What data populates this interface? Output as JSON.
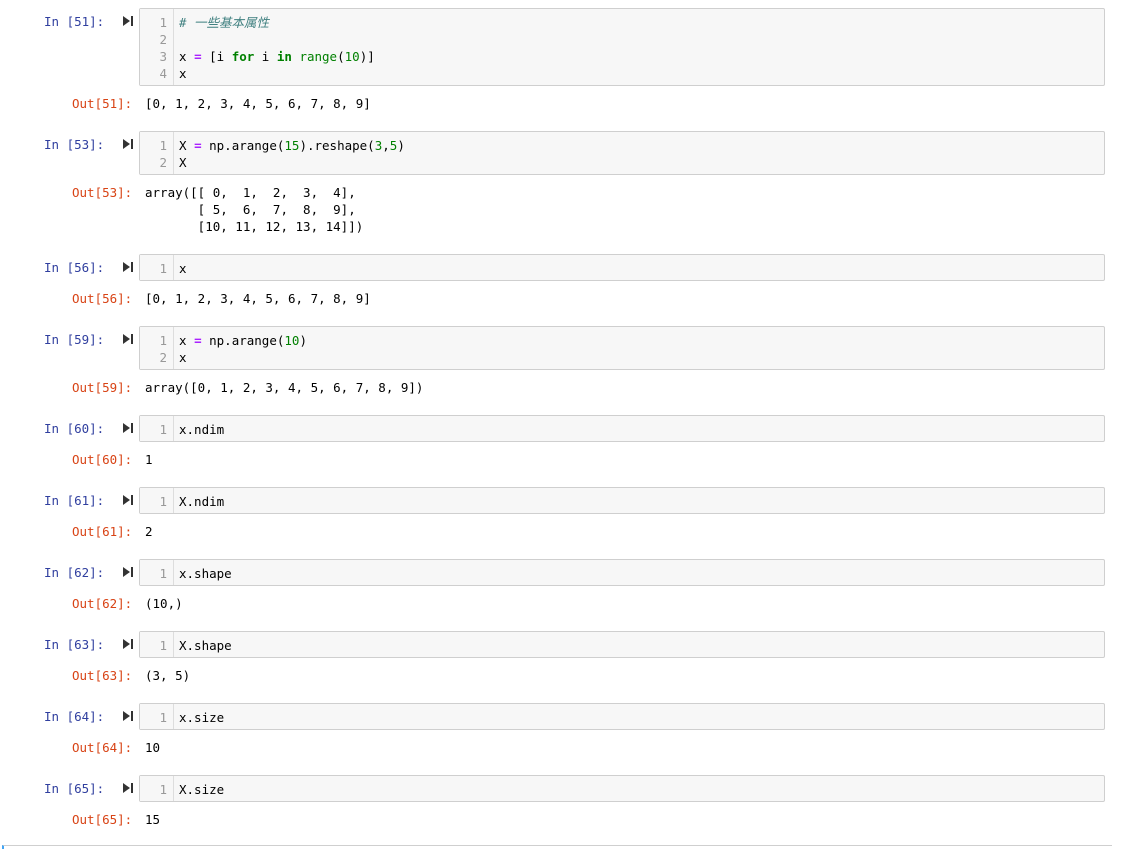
{
  "cells": [
    {
      "in_prompt": "In [51]:",
      "out_prompt": "Out[51]:",
      "lines": [
        {
          "num": "1",
          "tokens": [
            {
              "t": "# 一些基本属性",
              "c": "comment"
            }
          ]
        },
        {
          "num": "2",
          "tokens": []
        },
        {
          "num": "3",
          "tokens": [
            {
              "t": "x ",
              "c": ""
            },
            {
              "t": "=",
              "c": "op"
            },
            {
              "t": " [i ",
              "c": ""
            },
            {
              "t": "for",
              "c": "kw"
            },
            {
              "t": " i ",
              "c": ""
            },
            {
              "t": "in",
              "c": "kw"
            },
            {
              "t": " ",
              "c": ""
            },
            {
              "t": "range",
              "c": "builtin"
            },
            {
              "t": "(",
              "c": ""
            },
            {
              "t": "10",
              "c": "num"
            },
            {
              "t": ")]",
              "c": ""
            }
          ]
        },
        {
          "num": "4",
          "tokens": [
            {
              "t": "x",
              "c": ""
            }
          ]
        }
      ],
      "output": "[0, 1, 2, 3, 4, 5, 6, 7, 8, 9]"
    },
    {
      "in_prompt": "In [53]:",
      "out_prompt": "Out[53]:",
      "lines": [
        {
          "num": "1",
          "tokens": [
            {
              "t": "X ",
              "c": ""
            },
            {
              "t": "=",
              "c": "op"
            },
            {
              "t": " np.arange(",
              "c": ""
            },
            {
              "t": "15",
              "c": "num"
            },
            {
              "t": ").reshape(",
              "c": ""
            },
            {
              "t": "3",
              "c": "num"
            },
            {
              "t": ",",
              "c": ""
            },
            {
              "t": "5",
              "c": "num"
            },
            {
              "t": ")",
              "c": ""
            }
          ]
        },
        {
          "num": "2",
          "tokens": [
            {
              "t": "X",
              "c": ""
            }
          ]
        }
      ],
      "output": "array([[ 0,  1,  2,  3,  4],\n       [ 5,  6,  7,  8,  9],\n       [10, 11, 12, 13, 14]])"
    },
    {
      "in_prompt": "In [56]:",
      "out_prompt": "Out[56]:",
      "lines": [
        {
          "num": "1",
          "tokens": [
            {
              "t": "x",
              "c": ""
            }
          ]
        }
      ],
      "output": "[0, 1, 2, 3, 4, 5, 6, 7, 8, 9]"
    },
    {
      "in_prompt": "In [59]:",
      "out_prompt": "Out[59]:",
      "lines": [
        {
          "num": "1",
          "tokens": [
            {
              "t": "x ",
              "c": ""
            },
            {
              "t": "=",
              "c": "op"
            },
            {
              "t": " np.arange(",
              "c": ""
            },
            {
              "t": "10",
              "c": "num"
            },
            {
              "t": ")",
              "c": ""
            }
          ]
        },
        {
          "num": "2",
          "tokens": [
            {
              "t": "x",
              "c": ""
            }
          ]
        }
      ],
      "output": "array([0, 1, 2, 3, 4, 5, 6, 7, 8, 9])"
    },
    {
      "in_prompt": "In [60]:",
      "out_prompt": "Out[60]:",
      "lines": [
        {
          "num": "1",
          "tokens": [
            {
              "t": "x.ndim",
              "c": ""
            }
          ]
        }
      ],
      "output": "1"
    },
    {
      "in_prompt": "In [61]:",
      "out_prompt": "Out[61]:",
      "lines": [
        {
          "num": "1",
          "tokens": [
            {
              "t": "X.ndim",
              "c": ""
            }
          ]
        }
      ],
      "output": "2"
    },
    {
      "in_prompt": "In [62]:",
      "out_prompt": "Out[62]:",
      "lines": [
        {
          "num": "1",
          "tokens": [
            {
              "t": "x.shape",
              "c": ""
            }
          ]
        }
      ],
      "output": "(10,)"
    },
    {
      "in_prompt": "In [63]:",
      "out_prompt": "Out[63]:",
      "lines": [
        {
          "num": "1",
          "tokens": [
            {
              "t": "X.shape",
              "c": ""
            }
          ]
        }
      ],
      "output": "(3, 5)"
    },
    {
      "in_prompt": "In [64]:",
      "out_prompt": "Out[64]:",
      "lines": [
        {
          "num": "1",
          "tokens": [
            {
              "t": "x.size",
              "c": ""
            }
          ]
        }
      ],
      "output": "10"
    },
    {
      "in_prompt": "In [65]:",
      "out_prompt": "Out[65]:",
      "lines": [
        {
          "num": "1",
          "tokens": [
            {
              "t": "X.size",
              "c": ""
            }
          ]
        }
      ],
      "output": "15"
    }
  ],
  "icons": {
    "run_button": "run-cell-icon"
  },
  "colors": {
    "in_prompt": "#303f9f",
    "out_prompt": "#d84315",
    "code_bg": "#f7f7f7",
    "selection_bar": "#42a5f5"
  }
}
